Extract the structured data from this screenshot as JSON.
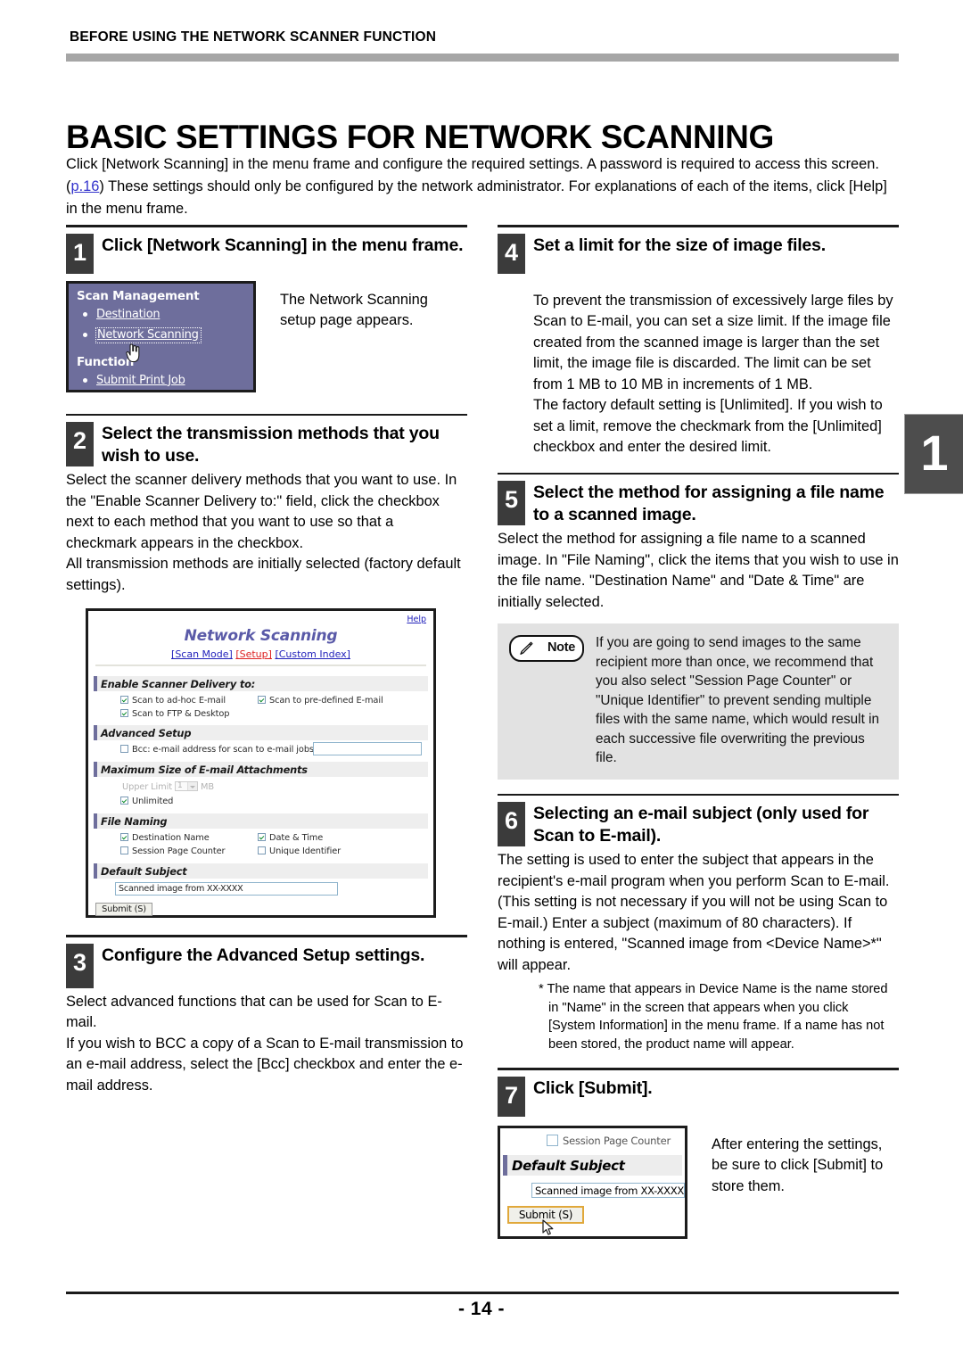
{
  "header": {
    "running_head": "BEFORE USING THE NETWORK SCANNER FUNCTION",
    "title": "BASIC SETTINGS FOR NETWORK SCANNING",
    "intro_part1": "Click [Network Scanning] in the menu frame and configure the required settings. A password is required to access this screen. (",
    "intro_link": "p.16",
    "intro_part2": ") These settings should only be configured by the network administrator. For explanations of each of the items, click [Help] in the menu frame."
  },
  "steps": {
    "s1": {
      "num": "1",
      "title": "Click [Network Scanning] in the menu frame.",
      "caption": "The Network Scanning setup page appears."
    },
    "s2": {
      "num": "2",
      "title": "Select the transmission methods that you wish to use.",
      "p1": "Select the scanner delivery methods that you want to use. In the \"Enable Scanner Delivery to:\" field, click the checkbox next to each method that you want to use so that a checkmark appears in the checkbox.",
      "p2": "All transmission methods are initially selected (factory default settings)."
    },
    "s3": {
      "num": "3",
      "title": "Configure the Advanced Setup settings.",
      "p1": "Select advanced functions that can be used for Scan to E-mail.",
      "p2": "If you wish to BCC a copy of a Scan to E-mail transmission to an e-mail address, select the [Bcc] checkbox and enter the e-mail address."
    },
    "s4": {
      "num": "4",
      "title": "Set a limit for the size of image files.",
      "p1": "To prevent the transmission of excessively large files by Scan to E-mail, you can set a size limit. If the image file created from the scanned image is larger than the set limit, the image file is discarded. The limit can be set from 1 MB to 10 MB in increments of 1 MB.",
      "p2": "The factory default setting is [Unlimited]. If you wish to set a limit, remove the checkmark from the [Unlimited] checkbox and enter the desired limit."
    },
    "s5": {
      "num": "5",
      "title": "Select the method for assigning a file name to a scanned image.",
      "p1": "Select the method for assigning a file name to a scanned image. In \"File Naming\", click the items that you wish to use in the file name. \"Destination Name\" and \"Date & Time\" are initially selected."
    },
    "s6": {
      "num": "6",
      "title": "Selecting an e-mail subject (only used for Scan to E-mail).",
      "p1": "The setting is used to enter the subject that appears in the recipient's e-mail program when you perform Scan to E-mail. (This setting is not necessary if you will not be using Scan to E-mail.) Enter a subject (maximum of 80 characters). If nothing is entered, \"Scanned image from <Device Name>*\" will appear.",
      "footnote": "* The name that appears in Device Name is the name stored in \"Name\" in the screen that appears when you click [System Information] in the menu frame. If a name has not been stored, the product name will appear."
    },
    "s7": {
      "num": "7",
      "title": "Click [Submit].",
      "caption": "After entering the settings, be sure to click [Submit] to store them."
    }
  },
  "note": {
    "label": "Note",
    "text": "If you are going to send images to the same recipient more than once, we recommend that you also select \"Session Page Counter\" or \"Unique Identifier\" to prevent sending multiple files with the same name, which would result in each successive file overwriting the previous file."
  },
  "menu_frame_shot": {
    "heading1": "Scan Management",
    "item_destination": "Destination",
    "item_network_scanning": "Network Scanning",
    "heading2": "Function",
    "item_submit_print_job": "Submit Print Job"
  },
  "setup_shot": {
    "help": "Help",
    "title": "Network Scanning",
    "tab_scan_mode": "[Scan Mode]",
    "tab_setup": "[Setup]",
    "tab_custom_index": "[Custom Index]",
    "section_enable": "Enable Scanner Delivery to:",
    "cb_adhoc": "Scan to ad-hoc E-mail",
    "cb_predefined": "Scan to pre-defined E-mail",
    "cb_ftp_desktop": "Scan to FTP & Desktop",
    "section_advanced": "Advanced Setup",
    "cb_bcc": "Bcc: e-mail address for scan to e-mail jobs",
    "bcc_value": "",
    "section_maxsize": "Maximum Size of E-mail Attachments",
    "upper_limit_label": "Upper Limit",
    "upper_limit_value": "1",
    "upper_limit_unit": "MB",
    "cb_unlimited": "Unlimited",
    "section_file_naming": "File Naming",
    "cb_destination_name": "Destination Name",
    "cb_date_time": "Date & Time",
    "cb_session_page_counter": "Session Page Counter",
    "cb_unique_identifier": "Unique Identifier",
    "section_default_subject": "Default Subject",
    "default_subject_value": "Scanned image from XX-XXXX",
    "submit_button": "Submit (S)"
  },
  "submit_shot": {
    "cb_session_page_counter": "Session Page Counter",
    "section_default_subject": "Default Subject",
    "subject_value": "Scanned image from XX-XXXX",
    "submit_button": "Submit (S)"
  },
  "side_tab": {
    "number": "1"
  },
  "footer": {
    "page_number": "- 14 -"
  },
  "colors": {
    "menu_frame_bg": "#6e6e9c",
    "section_accent": "#6e6e9c",
    "step_badge": "#3b3b3b",
    "link_blue": "#2222bb",
    "tab_active_red": "#dd2222",
    "note_bg": "#e2e2e2",
    "rule_gray": "#a6a6a6",
    "side_tab_bg": "#4d4d4d"
  }
}
